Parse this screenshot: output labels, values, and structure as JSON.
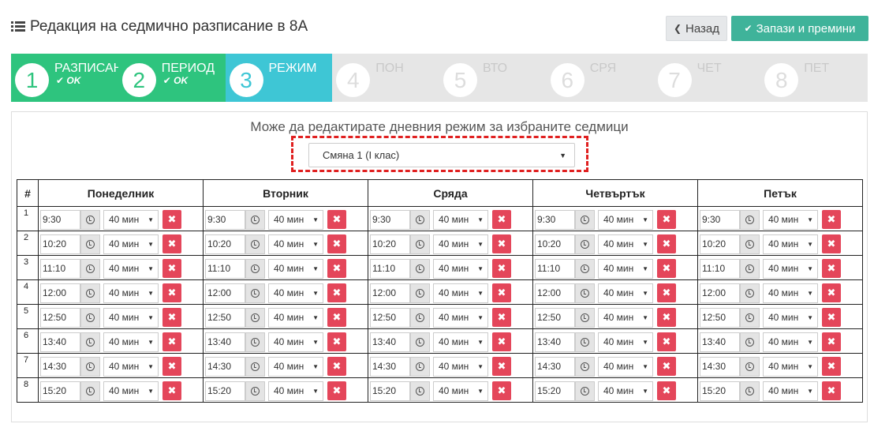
{
  "header": {
    "title": "Редакция на седмично разписание в 8А",
    "back_label": "Назад",
    "save_label": "Запази и премини"
  },
  "wizard": {
    "steps": [
      {
        "num": "1",
        "label": "РАЗПИСАН",
        "status": "OK",
        "state": "done"
      },
      {
        "num": "2",
        "label": "ПЕРИОД",
        "status": "OK",
        "state": "done"
      },
      {
        "num": "3",
        "label": "РЕЖИМ",
        "status": "",
        "state": "active"
      },
      {
        "num": "4",
        "label": "ПОН",
        "status": "",
        "state": "todo"
      },
      {
        "num": "5",
        "label": "ВТО",
        "status": "",
        "state": "todo"
      },
      {
        "num": "6",
        "label": "СРЯ",
        "status": "",
        "state": "todo"
      },
      {
        "num": "7",
        "label": "ЧЕТ",
        "status": "",
        "state": "todo"
      },
      {
        "num": "8",
        "label": "ПЕТ",
        "status": "",
        "state": "todo"
      }
    ]
  },
  "panel": {
    "subtitle": "Може да редактирате дневния режим за избраните седмици",
    "shift_value": "Смяна 1 (I клас)"
  },
  "table": {
    "num_header": "#",
    "days": [
      "Понеделник",
      "Вторник",
      "Сряда",
      "Четвъртък",
      "Петък"
    ],
    "rows": [
      {
        "idx": "1",
        "time": "9:30",
        "duration": "40 мин"
      },
      {
        "idx": "2",
        "time": "10:20",
        "duration": "40 мин"
      },
      {
        "idx": "3",
        "time": "11:10",
        "duration": "40 мин"
      },
      {
        "idx": "4",
        "time": "12:00",
        "duration": "40 мин"
      },
      {
        "idx": "5",
        "time": "12:50",
        "duration": "40 мин"
      },
      {
        "idx": "6",
        "time": "13:40",
        "duration": "40 мин"
      },
      {
        "idx": "7",
        "time": "14:30",
        "duration": "40 мин"
      },
      {
        "idx": "8",
        "time": "15:20",
        "duration": "40 мин"
      }
    ]
  },
  "colors": {
    "done": "#2ec47e",
    "active": "#3ec6d5",
    "save": "#3fb39a",
    "delete": "#e4465a",
    "highlight": "#e02020"
  },
  "icons": {
    "title": "list-icon",
    "back": "chevron-left-icon",
    "save": "check-icon",
    "ok": "check-icon",
    "clock": "clock-icon",
    "delete": "close-icon"
  }
}
